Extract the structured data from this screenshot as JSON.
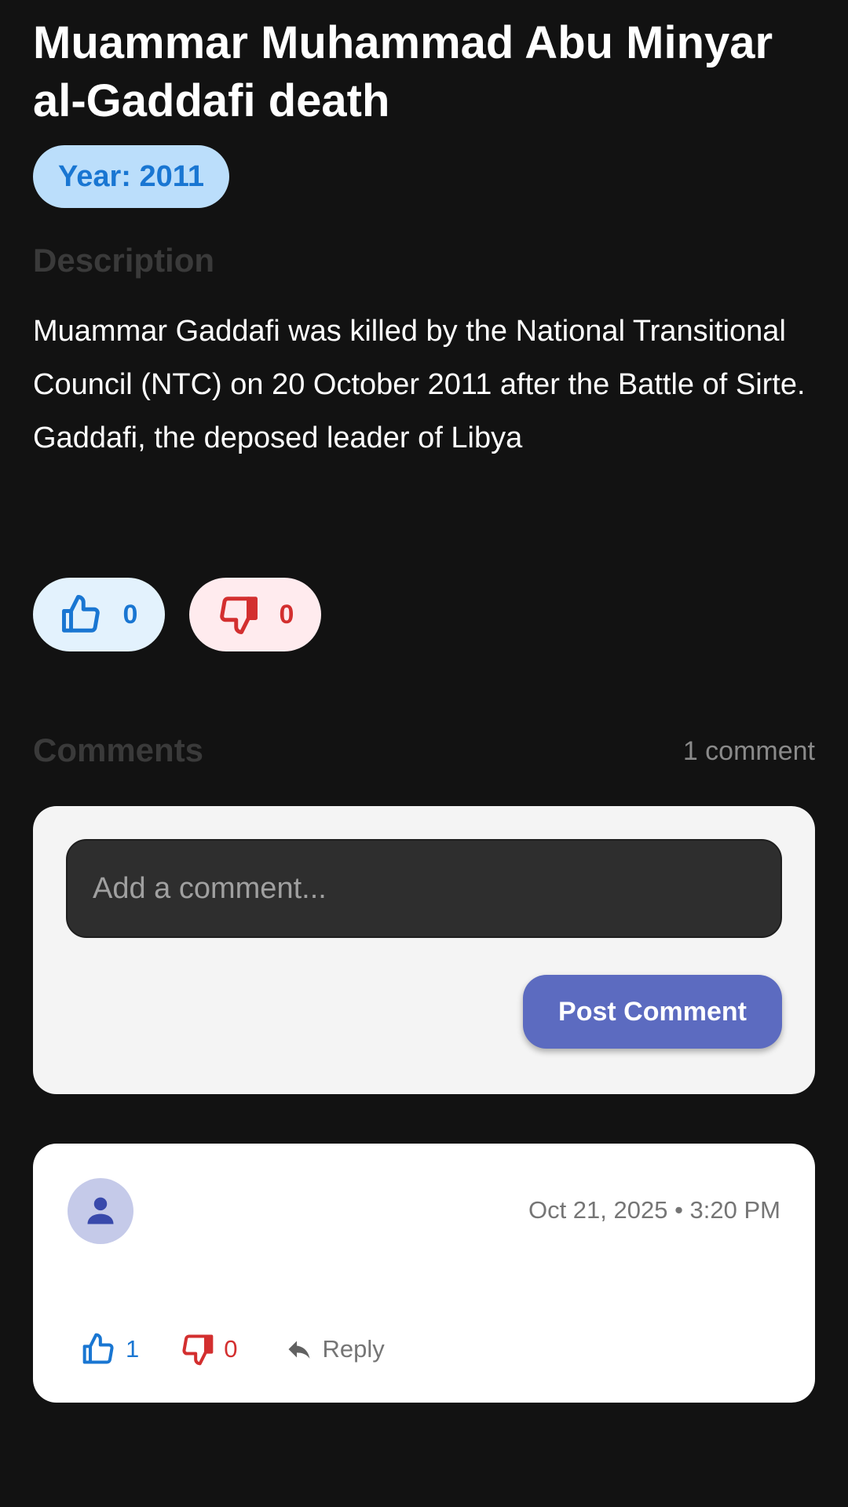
{
  "event": {
    "title": "Muammar Muhammad Abu Minyar al-Gaddafi death",
    "year_chip": "Year: 2011"
  },
  "description": {
    "heading": "Description",
    "text": "Muammar Gaddafi was killed by the National Transitional Council (NTC) on 20 October 2011 after the Battle of Sirte. Gaddafi, the deposed leader of Libya"
  },
  "votes": {
    "likes": "0",
    "dislikes": "0"
  },
  "comments": {
    "heading": "Comments",
    "count_label": "1 comment",
    "input_placeholder": "Add a comment...",
    "post_label": "Post Comment",
    "items": [
      {
        "avatar_icon": "person-icon",
        "timestamp": "Oct 21, 2025 • 3:20 PM",
        "likes": "1",
        "dislikes": "0",
        "reply_label": "Reply"
      }
    ]
  },
  "colors": {
    "background": "#121212",
    "like_blue": "#1976d2",
    "dislike_red": "#d32f2f",
    "accent_indigo": "#5c6bc0",
    "chip_bg": "#bbdefb"
  }
}
